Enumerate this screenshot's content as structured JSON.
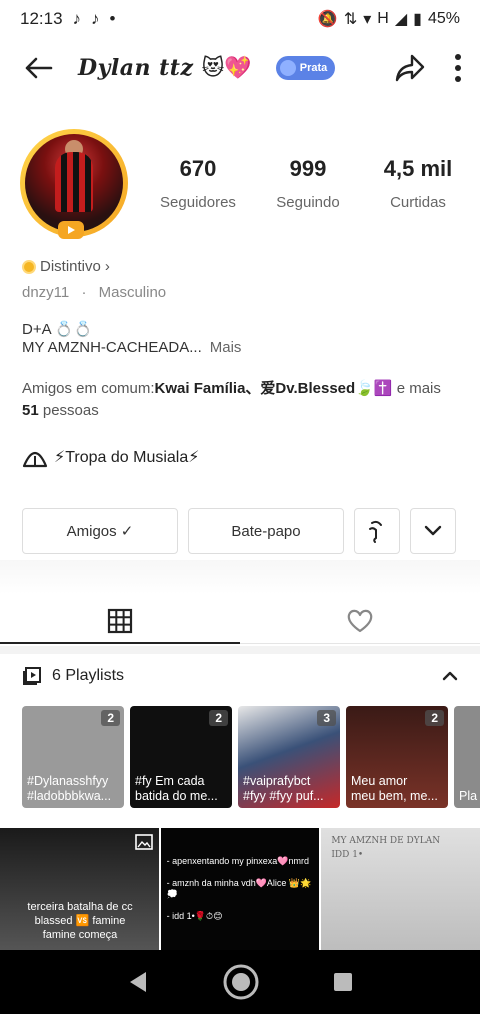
{
  "status_bar": {
    "time": "12:13",
    "network": "H",
    "battery": "45%"
  },
  "header": {
    "username": "Dylan  ttz",
    "emojis": "😻💖",
    "badge": "Prata"
  },
  "stats": [
    {
      "value": "670",
      "label": "Seguidores"
    },
    {
      "value": "999",
      "label": "Seguindo"
    },
    {
      "value": "4,5 mil",
      "label": "Curtidas"
    }
  ],
  "profile": {
    "distintivo": "Distintivo",
    "handle": "dnzy11",
    "separator": "·",
    "gender": "Masculino",
    "bio_line1": "D+A 💍💍",
    "bio_line2": "MY AMZNH-CACHEADA...",
    "bio_more": "Mais",
    "friends_prefix": "Amigos em comum:",
    "friends_names": "Kwai Família、爱Dv.Blessed🍃✝️",
    "friends_suffix": " e mais",
    "friends_count": "51",
    "friends_unit": " pessoas",
    "group": "⚡Tropa do Musiala⚡"
  },
  "actions": {
    "friends_button": "Amigos ✓",
    "message_button": "Bate-papo"
  },
  "playlists": {
    "header": "6 Playlists",
    "items": [
      {
        "title": "#Dylanasshfyy\n#ladobbbkwa...",
        "count": "2",
        "color": "#9a9a9a"
      },
      {
        "title": "#fy Em cada\nbatida do me...",
        "count": "2",
        "color": "#0f0f0f"
      },
      {
        "title": "#vaiprafybct\n#fyy #fyy puf...",
        "count": "3",
        "color": "#3a5178"
      },
      {
        "title": "Meu amor\nmeu bem, me...",
        "count": "2",
        "color": "#6b2b22"
      },
      {
        "title": "Pla",
        "count": "",
        "color": "#8b8b8b"
      }
    ]
  },
  "grid": [
    {
      "text": "terceira batalha de cc\nblassed 🆚 famine\nfamine começa",
      "color": "#2a2a2a"
    },
    {
      "text": "- apenxentando my pinxexa🩷nmrd\n\n- amznh da minha vdh🩷Alice 👑🌟💭\n\n- idd 1•🌹⏱😊",
      "color": "#050505"
    },
    {
      "text": "MY AMZNH DE DYLAN\nIDD 1•",
      "color": "#cfcfcf"
    }
  ]
}
